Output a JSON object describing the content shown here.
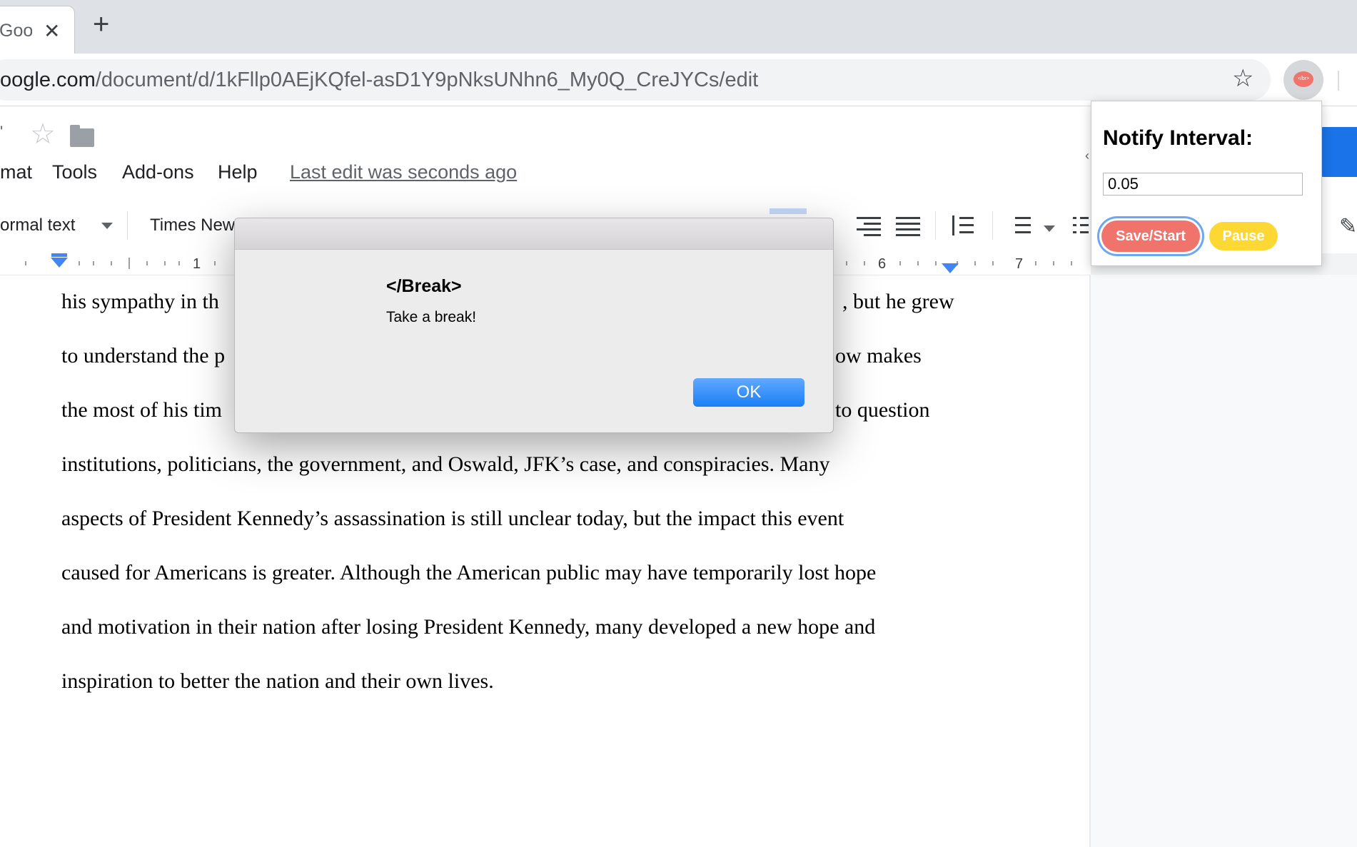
{
  "browser": {
    "tab_title": "Goo",
    "tab_close": "✕",
    "new_tab": "+",
    "url_host": "oogle.com",
    "url_path": "/document/d/1kFllp0AEjKQfel-asD1Y9pNksUNhn6_My0Q_CreJYCs/edit",
    "bookmark_icon": "star-outline-icon",
    "extension_icon": "break-extension-icon",
    "extension_logo_text": "</br>"
  },
  "docs": {
    "menu": {
      "format": "mat",
      "tools": "Tools",
      "addons": "Add-ons",
      "help": "Help",
      "last_edit": "Last edit was seconds ago"
    },
    "toolbar": {
      "style": "ormal text",
      "font": "Times New"
    },
    "ruler": {
      "marks": [
        "1",
        "6",
        "7"
      ]
    },
    "body_lines": [
      "his sympathy in th",
      ", but he grew",
      "to understand the p",
      "ow makes",
      "the most of his tim",
      "to question",
      "institutions, politicians, the government, and Oswald, JFK’s case, and conspiracies. Many",
      "aspects of President Kennedy’s assassination is still unclear today, but the impact this event",
      "caused for Americans is greater. Although the American public may have temporarily lost hope",
      "and motivation in their nation after losing President Kennedy, many developed a new hope and",
      "inspiration to better the nation and their own lives."
    ]
  },
  "dialog": {
    "title": "</Break>",
    "message": "Take a break!",
    "ok_label": "OK"
  },
  "popup": {
    "heading": "Notify Interval:",
    "interval_value": "0.05",
    "save_label": "Save/Start",
    "pause_label": "Pause",
    "colors": {
      "save": "#f0736c",
      "pause": "#fdd835"
    }
  }
}
